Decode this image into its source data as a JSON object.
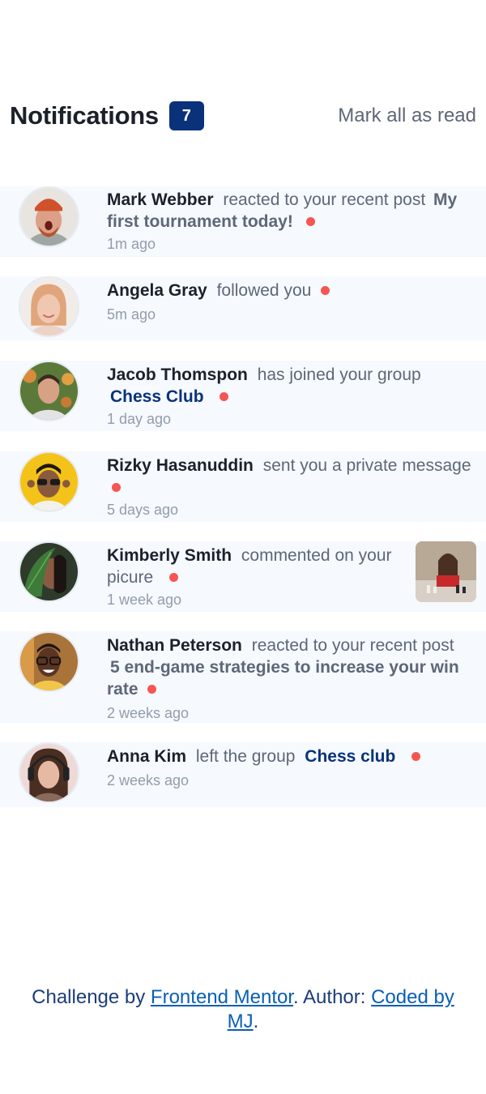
{
  "header": {
    "title": "Notifications",
    "unread_count": "7",
    "mark_all_label": "Mark all as read"
  },
  "notifications": [
    {
      "name": "Mark Webber",
      "action": "reacted to your recent post",
      "post": "My first tournament today!",
      "time": "1m ago",
      "avatar_icon": "person-avatar-icon",
      "unread": true
    },
    {
      "name": "Angela Gray",
      "action": "followed you",
      "time": "5m ago",
      "avatar_icon": "person-avatar-icon",
      "unread": true
    },
    {
      "name": "Jacob Thomspon",
      "action": "has joined your group",
      "group": "Chess Club",
      "time": "1 day ago",
      "avatar_icon": "person-avatar-icon",
      "unread": true
    },
    {
      "name": "Rizky Hasanuddin",
      "action": "sent you a private message",
      "time": "5 days ago",
      "avatar_icon": "person-avatar-icon",
      "unread": true
    },
    {
      "name": "Kimberly Smith",
      "action": "commented on your picure",
      "time": "1 week ago",
      "avatar_icon": "person-avatar-icon",
      "thumbnail_icon": "chess-picture-icon",
      "unread": true
    },
    {
      "name": "Nathan Peterson",
      "action": "reacted to your recent post",
      "post": "5 end-game strategies to increase your win rate",
      "time": "2 weeks ago",
      "avatar_icon": "person-avatar-icon",
      "unread": true
    },
    {
      "name": "Anna Kim",
      "action": "left the group",
      "group": "Chess club",
      "time": "2 weeks ago",
      "avatar_icon": "person-avatar-icon",
      "unread": true
    }
  ],
  "footer": {
    "prefix": "Challenge by ",
    "link1": "Frontend Mentor",
    "middle": ". Author: ",
    "link2": "Coded by MJ",
    "suffix": "."
  },
  "colors": {
    "accent": "#0a327b",
    "unread_dot": "#f65552",
    "unread_bg": "#f6f9fd",
    "heading": "#1c202b",
    "muted": "#5e6778"
  }
}
